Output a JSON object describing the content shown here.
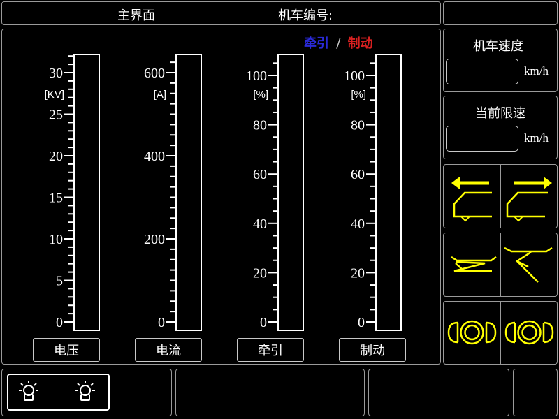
{
  "header": {
    "title": "主界面",
    "locomotive_number_label": "机车编号:"
  },
  "legend": {
    "traction": "牵引",
    "separator": "/",
    "braking": "制动",
    "traction_color": "#2a2ad8",
    "braking_color": "#d82020"
  },
  "gauges": [
    {
      "name": "voltage",
      "unit": "[KV]",
      "label": "电压",
      "min": 0,
      "max": 30,
      "major_ticks": [
        0,
        5,
        10,
        15,
        20,
        25,
        30
      ],
      "value": 0
    },
    {
      "name": "current",
      "unit": "[A]",
      "label": "电流",
      "min": 0,
      "max": 600,
      "major_ticks": [
        0,
        200,
        400,
        600
      ],
      "value": 0
    },
    {
      "name": "traction",
      "unit": "[%]",
      "label": "牵引",
      "min": 0,
      "max": 110,
      "major_ticks": [
        0,
        20,
        40,
        60,
        80,
        100
      ],
      "value": 0
    },
    {
      "name": "braking",
      "unit": "[%]",
      "label": "制动",
      "min": 0,
      "max": 110,
      "major_ticks": [
        0,
        20,
        40,
        60,
        80,
        100
      ],
      "value": 0
    }
  ],
  "speed": {
    "title": "机车速度",
    "value": "",
    "unit": "km/h"
  },
  "speed_limit": {
    "title": "当前限速",
    "value": "",
    "unit": "km/h"
  },
  "icons": {
    "accent_color": "#ffff00",
    "row1": [
      "direction-left-icon",
      "direction-right-icon"
    ],
    "row2": [
      "pantograph-down-icon",
      "pantograph-up-icon"
    ],
    "row3": [
      "main-circuit-breaker-left-icon",
      "main-circuit-breaker-right-icon"
    ]
  },
  "footer": {
    "lamp_icons": [
      "headlight-left-icon",
      "headlight-right-icon"
    ]
  }
}
